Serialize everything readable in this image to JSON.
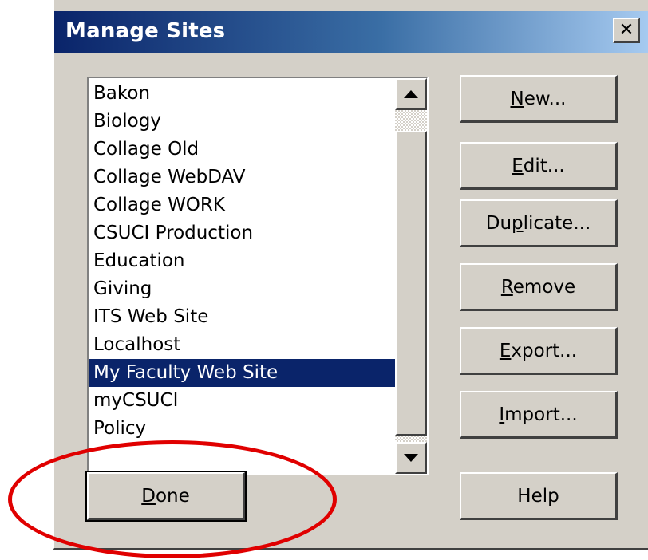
{
  "window": {
    "title": "Manage Sites",
    "close_glyph": "✕"
  },
  "sites_list": {
    "items": [
      "Bakon",
      "Biology",
      "Collage Old",
      "Collage WebDAV",
      "Collage WORK",
      "CSUCI Production",
      "Education",
      "Giving",
      "ITS Web Site",
      "Localhost",
      "My Faculty Web Site",
      "myCSUCI",
      "Policy"
    ],
    "selected_index": 10
  },
  "buttons": {
    "new": {
      "pre": "",
      "key": "N",
      "post": "ew..."
    },
    "edit": {
      "pre": "",
      "key": "E",
      "post": "dit..."
    },
    "duplicate": {
      "pre": "Du",
      "key": "p",
      "post": "licate..."
    },
    "remove": {
      "pre": "",
      "key": "R",
      "post": "emove"
    },
    "export": {
      "pre": "",
      "key": "E",
      "post": "xport..."
    },
    "import": {
      "pre": "",
      "key": "I",
      "post": "mport..."
    },
    "done": {
      "pre": "",
      "key": "D",
      "post": "one"
    },
    "help": {
      "label": "Help"
    }
  },
  "colors": {
    "dialog_bg": "#d4d0c8",
    "titlebar_start": "#0a246a",
    "titlebar_end": "#a6caf0",
    "selection": "#0a246a",
    "annotation": "#e00000"
  },
  "icons": {
    "scroll_up": "triangle-up-icon",
    "scroll_down": "triangle-down-icon",
    "close": "close-icon"
  }
}
